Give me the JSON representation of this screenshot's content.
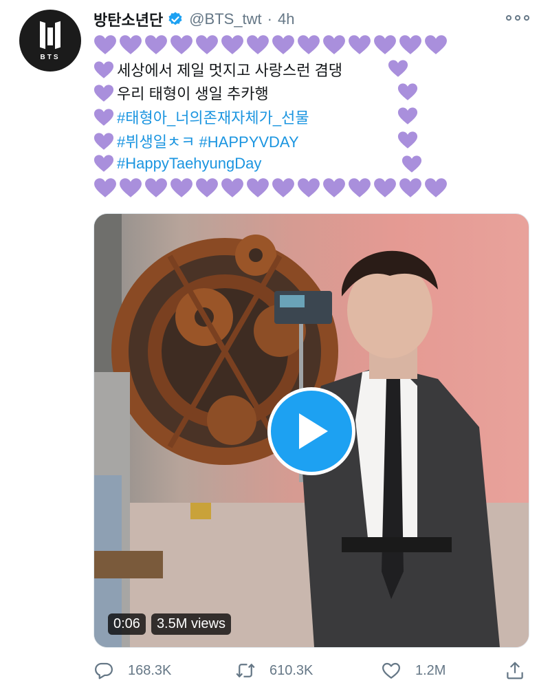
{
  "tweet": {
    "display_name": "방탄소년단",
    "handle": "@BTS_twt",
    "separator": "·",
    "time": "4h",
    "avatar_text": "BTS",
    "lines": [
      {
        "text": "세상에서 제일 멋지고 사랑스런 겸댕",
        "type": "text"
      },
      {
        "text": "우리 태형이 생일 추카행",
        "type": "text"
      },
      {
        "text": "#태형아_너의존재자체가_선물",
        "type": "hashtag"
      },
      {
        "text": "#뷔생일ㅊㅋ #HAPPYVDAY",
        "type": "hashtag"
      },
      {
        "text": "#HappyTaehyungDay",
        "type": "hashtag"
      }
    ],
    "heart_color": "#a98fdc",
    "link_color": "#1b95e0"
  },
  "media": {
    "duration": "0:06",
    "views": "3.5M views"
  },
  "actions": {
    "replies": "168.3K",
    "retweets": "610.3K",
    "likes": "1.2M"
  },
  "icons": {
    "verified": "verified-badge-icon",
    "more": "more-options-icon",
    "reply": "reply-icon",
    "retweet": "retweet-icon",
    "like": "heart-outline-icon",
    "share": "share-icon",
    "play": "play-icon"
  }
}
